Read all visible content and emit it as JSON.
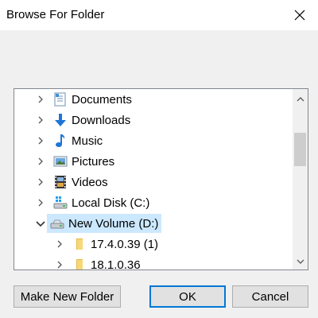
{
  "window": {
    "title": "Browse For Folder",
    "close_icon": "close-icon"
  },
  "tree": {
    "items": [
      {
        "label": "Documents",
        "icon": "documents-folder-icon",
        "expanded": false,
        "level": 0
      },
      {
        "label": "Downloads",
        "icon": "downloads-arrow-icon",
        "expanded": false,
        "level": 0
      },
      {
        "label": "Music",
        "icon": "music-note-icon",
        "expanded": false,
        "level": 0
      },
      {
        "label": "Pictures",
        "icon": "pictures-icon",
        "expanded": false,
        "level": 0
      },
      {
        "label": "Videos",
        "icon": "videos-film-icon",
        "expanded": false,
        "level": 0
      },
      {
        "label": "Local Disk (C:)",
        "icon": "windows-drive-icon",
        "expanded": false,
        "level": 0
      },
      {
        "label": "New Volume (D:)",
        "icon": "drive-icon",
        "expanded": true,
        "level": 0,
        "selected": true
      },
      {
        "label": "17.4.0.39 (1)",
        "icon": "folder-icon",
        "expanded": false,
        "level": 1
      },
      {
        "label": "18.1.0.36",
        "icon": "folder-icon",
        "expanded": false,
        "level": 1
      }
    ]
  },
  "buttons": {
    "make_new_folder": "Make New Folder",
    "ok": "OK",
    "cancel": "Cancel"
  },
  "colors": {
    "selection": "#cce8ff",
    "default_button_border": "#0078d7",
    "folder": "#f8d775"
  }
}
